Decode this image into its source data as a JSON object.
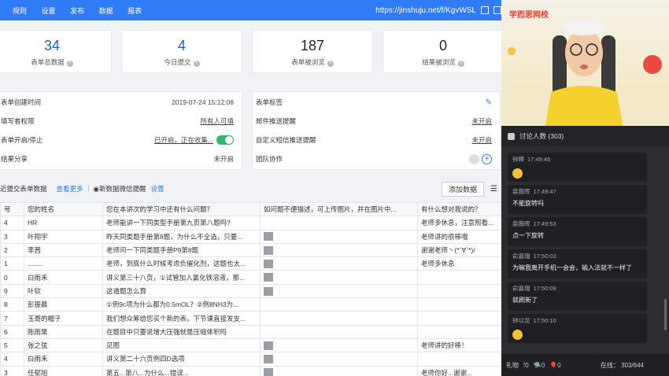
{
  "topbar": {
    "nav": [
      "规则",
      "设置",
      "发布",
      "数据",
      "报表"
    ],
    "url": "https://jinshuju.net/f/KgvWSL"
  },
  "stats": [
    {
      "value": "34",
      "label": "表单总数据"
    },
    {
      "value": "4",
      "label": "今日提交"
    },
    {
      "value": "187",
      "label": "表单被浏览"
    },
    {
      "value": "0",
      "label": "结果被浏览"
    }
  ],
  "info_left": [
    {
      "label": "表单创建时间",
      "value": "2019-07-24 15:12:08"
    },
    {
      "label": "填写者权限",
      "value": "所有人可填"
    },
    {
      "label": "表单开启/停止",
      "value": "已开启，正在收集..."
    },
    {
      "label": "结果分享",
      "value": "未开启"
    }
  ],
  "info_right": [
    {
      "label": "表单标签",
      "value": ""
    },
    {
      "label": "邮件推送提醒",
      "value": "未开启"
    },
    {
      "label": "自定义短信推送提醒",
      "value": "未开启"
    },
    {
      "label": "团队协作",
      "value": ""
    }
  ],
  "subbar": {
    "title": "近提交表单数据",
    "view_more": "查看更多",
    "wechat": "新数据微信提醒",
    "settings": "设置",
    "add_button": "添加数据"
  },
  "table": {
    "headers": [
      "号",
      "您的姓名",
      "您在本讲次的学习中还有什么问题？",
      "如问题不便描述，可上传图片，并在图片中...",
      "有什么想对我说的？"
    ],
    "rows": [
      {
        "id": "4",
        "name": "HR",
        "q": "老师能讲一下同类型手册第九页第八题吗?",
        "img": false,
        "msg": "老师多休息，注意照看..."
      },
      {
        "id": "3",
        "name": "叶翔宇",
        "q": "昨天同类题手册第8题，为什么不全选，只要...",
        "img": true,
        "msg": "老师讲的很棒哦"
      },
      {
        "id": "2",
        "name": "李茜",
        "q": "老师问一下同类题手册P9第8题",
        "img": true,
        "msg": "谢谢老师丶(*´∀`*)/"
      },
      {
        "id": "1",
        "name": "........",
        "q": "老师，到底什么时候考虑负催化剂，这题也太...",
        "img": true,
        "msg": "老师多休息"
      },
      {
        "id": "0",
        "name": "白雨禾",
        "q": "讲义第三十八页，①试管加入氯化铁溶液，那...",
        "img": true,
        "msg": ""
      },
      {
        "id": "9",
        "name": "叶钦",
        "q": "这道题怎么算",
        "img": true,
        "msg": ""
      },
      {
        "id": "8",
        "name": "彭振晨",
        "q": "①例9c项为什么都为0.5mOL？②例8NH3为...",
        "img": false,
        "msg": ""
      },
      {
        "id": "7",
        "name": "玉哥的帽子",
        "q": "我们想众筹给您买个新的表，下节课直接发支...",
        "img": false,
        "msg": ""
      },
      {
        "id": "6",
        "name": "陈雨昊",
        "q": "在题目中只要说增大压强就是压缩体积吗",
        "img": false,
        "msg": ""
      },
      {
        "id": "5",
        "name": "张之弦",
        "q": "见图",
        "img": true,
        "msg": "老师讲的好棒！"
      },
      {
        "id": "4",
        "name": "白雨禾",
        "q": "讲义第二十六页例四D选项",
        "img": true,
        "msg": ""
      },
      {
        "id": "3",
        "name": "任郁旭",
        "q": "第五...第八...为什么...错误...",
        "img": true,
        "msg": "老师你好...谢谢..."
      }
    ]
  },
  "video": {
    "brand": "学而思网校"
  },
  "chat": {
    "title": "讨论人数 (303)",
    "messages": [
      {
        "user": "钟釋",
        "time": "17:49:46",
        "text": "",
        "emoji": true
      },
      {
        "user": "裴薇晖",
        "time": "17:49:47",
        "text": "不能旋转吗",
        "emoji": false
      },
      {
        "user": "裴薇晖",
        "time": "17:49:53",
        "text": "点一下旋转",
        "emoji": false
      },
      {
        "user": "俞嘉瑞",
        "time": "17:50:03",
        "text": "为嘛我离开手机一会会，输入法就不一样了",
        "emoji": false
      },
      {
        "user": "俞嘉瑞",
        "time": "17:50:09",
        "text": "就刷新了",
        "emoji": false
      },
      {
        "user": "钟以龙",
        "time": "17:50:10",
        "text": "",
        "emoji": true
      }
    ],
    "gift_label": "礼物",
    "gifts": [
      "0",
      "0",
      "0"
    ],
    "online": "在线： 303/644"
  }
}
